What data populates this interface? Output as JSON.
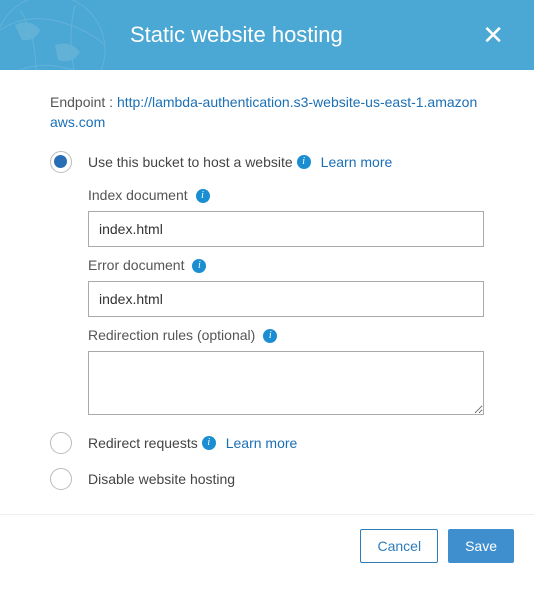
{
  "header": {
    "title": "Static website hosting",
    "close_label": "✕"
  },
  "endpoint": {
    "label": "Endpoint : ",
    "url": "http://lambda-authentication.s3-website-us-east-1.amazonaws.com"
  },
  "options": {
    "host": {
      "label": "Use this bucket to host a website",
      "learn_more": "Learn more"
    },
    "redirect": {
      "label": "Redirect requests",
      "learn_more": "Learn more"
    },
    "disable": {
      "label": "Disable website hosting"
    }
  },
  "fields": {
    "index_document": {
      "label": "Index document",
      "value": "index.html"
    },
    "error_document": {
      "label": "Error document",
      "value": "index.html"
    },
    "redirection_rules": {
      "label": "Redirection rules (optional)",
      "value": ""
    }
  },
  "footer": {
    "cancel": "Cancel",
    "save": "Save"
  },
  "info_glyph": "i"
}
